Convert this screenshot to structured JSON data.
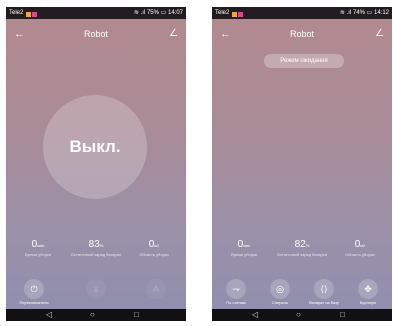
{
  "screens": [
    {
      "status": {
        "carrier": "Tele2",
        "battery": "75%",
        "time": "14:07"
      },
      "header": {
        "title": "Robot",
        "back_icon": "←",
        "edit_icon": "∠"
      },
      "power_state": "Выкл.",
      "stats": [
        {
          "value": "0",
          "unit": "мин",
          "label": "Время уборки"
        },
        {
          "value": "83",
          "unit": "%",
          "label": "Остаточный заряд батареи"
        },
        {
          "value": "0",
          "unit": "м2",
          "label": "Область уборки"
        }
      ],
      "actions": [
        {
          "icon": "⏻",
          "label": "Переключатель",
          "icon_name": "power-icon",
          "enabled": true
        },
        {
          "icon": "⧖",
          "label": "",
          "icon_name": "timer-icon",
          "enabled": false
        },
        {
          "icon": "A",
          "label": "",
          "icon_name": "auto-mode-icon",
          "enabled": false
        }
      ],
      "nav": {
        "back": "◁",
        "home": "○",
        "recent": "□"
      }
    },
    {
      "status": {
        "carrier": "Tele2",
        "battery": "74%",
        "time": "14:12"
      },
      "header": {
        "title": "Robot",
        "back_icon": "←",
        "edit_icon": "∠"
      },
      "mode_badge": "Режим ожидания",
      "stats": [
        {
          "value": "0",
          "unit": "мин",
          "label": "Время уборки"
        },
        {
          "value": "82",
          "unit": "%",
          "label": "Остаточный заряд батареи"
        },
        {
          "value": "0",
          "unit": "м2",
          "label": "Область уборки"
        }
      ],
      "actions": [
        {
          "icon": "⇁",
          "label": "По стенам",
          "icon_name": "wall-follow-icon",
          "enabled": true
        },
        {
          "icon": "◎",
          "label": "Спираль",
          "icon_name": "spiral-icon",
          "enabled": true
        },
        {
          "icon": "⟨⟩",
          "label": "Возврат на базу",
          "icon_name": "return-dock-icon",
          "enabled": true
        },
        {
          "icon": "✥",
          "label": "Вручную",
          "icon_name": "manual-control-icon",
          "enabled": true
        }
      ],
      "nav": {
        "back": "◁",
        "home": "○",
        "recent": "□"
      }
    }
  ],
  "colors": {
    "status_bar": "#221b20",
    "gradient_top": "#b28a8e",
    "gradient_bottom": "#8f8faf",
    "text": "#ffffff"
  }
}
